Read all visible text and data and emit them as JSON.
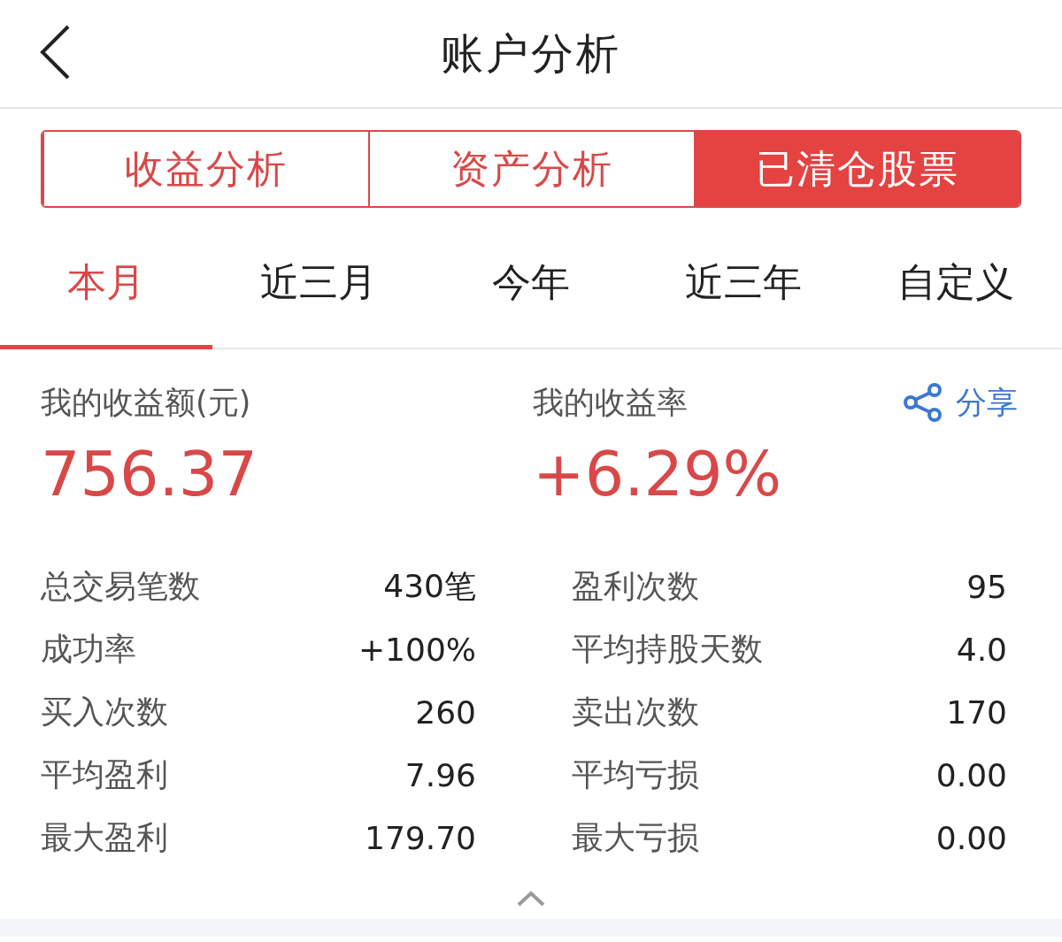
{
  "header": {
    "title": "账户分析"
  },
  "segments": [
    {
      "label": "收益分析",
      "selected": false
    },
    {
      "label": "资产分析",
      "selected": false
    },
    {
      "label": "已清仓股票",
      "selected": true
    }
  ],
  "periods": [
    {
      "label": "本月",
      "selected": true
    },
    {
      "label": "近三月",
      "selected": false
    },
    {
      "label": "今年",
      "selected": false
    },
    {
      "label": "近三年",
      "selected": false
    },
    {
      "label": "自定义",
      "selected": false
    }
  ],
  "summary": {
    "profit_label": "我的收益额(元)",
    "profit_value": "756.37",
    "rate_label": "我的收益率",
    "rate_value": "+6.29%",
    "share_label": "分享"
  },
  "stats": [
    {
      "label": "总交易笔数",
      "value": "430笔"
    },
    {
      "label": "盈利次数",
      "value": "95"
    },
    {
      "label": "成功率",
      "value": "+100%"
    },
    {
      "label": "平均持股天数",
      "value": "4.0"
    },
    {
      "label": "买入次数",
      "value": "260"
    },
    {
      "label": "卖出次数",
      "value": "170"
    },
    {
      "label": "平均盈利",
      "value": "7.96"
    },
    {
      "label": "平均亏损",
      "value": "0.00"
    },
    {
      "label": "最大盈利",
      "value": "179.70"
    },
    {
      "label": "最大亏损",
      "value": "0.00"
    }
  ]
}
